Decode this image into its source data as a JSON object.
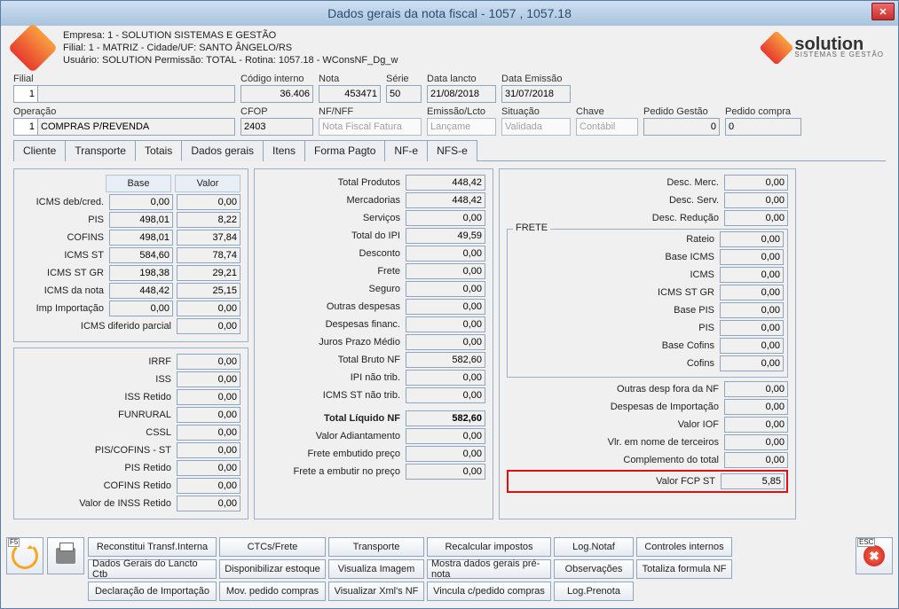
{
  "window": {
    "title": "Dados gerais da nota fiscal - 1057 , 1057.18"
  },
  "header": {
    "empresa_line": "Empresa: 1 - SOLUTION SISTEMAS E GESTÃO",
    "filial_line": "Filial: 1 - MATRIZ - Cidade/UF: SANTO ÂNGELO/RS",
    "usuario_line": "Usuário: SOLUTION          Permissão: TOTAL - Rotina: 1057.18 - WConsNF_Dg_w",
    "brand": "solution",
    "brand_sub": "SISTEMAS E GESTÃO"
  },
  "top": {
    "filial": {
      "label": "Filial",
      "num": "1",
      "text": ""
    },
    "codigo_interno": {
      "label": "Código interno",
      "value": "36.406"
    },
    "nota": {
      "label": "Nota",
      "value": "453471"
    },
    "serie": {
      "label": "Série",
      "value": "50"
    },
    "data_lancto": {
      "label": "Data lancto",
      "value": "21/08/2018"
    },
    "data_emissao": {
      "label": "Data Emissão",
      "value": "31/07/2018"
    },
    "operacao": {
      "label": "Operação",
      "num": "1",
      "text": "COMPRAS P/REVENDA"
    },
    "cfop": {
      "label": "CFOP",
      "value": "2403"
    },
    "nfnff": {
      "label": "NF/NFF",
      "value": "Nota Fiscal Fatura"
    },
    "emissao_lcto": {
      "label": "Emissão/Lcto",
      "value": "Lançame"
    },
    "situacao": {
      "label": "Situação",
      "value": "Validada"
    },
    "chave": {
      "label": "Chave",
      "value": "Contábil"
    },
    "pedido_gestao": {
      "label": "Pedido Gestão",
      "value": "0"
    },
    "pedido_compra": {
      "label": "Pedido compra",
      "value": "0"
    }
  },
  "tabs": [
    "Cliente",
    "Transporte",
    "Totais",
    "Dados gerais",
    "Itens",
    "Forma Pagto",
    "NF-e",
    "NFS-e"
  ],
  "active_tab": "Totais",
  "col1a": {
    "hdr_base": "Base",
    "hdr_valor": "Valor",
    "rows": [
      {
        "lbl": "ICMS deb/cred.",
        "base": "0,00",
        "valor": "0,00"
      },
      {
        "lbl": "PIS",
        "base": "498,01",
        "valor": "8,22"
      },
      {
        "lbl": "COFINS",
        "base": "498,01",
        "valor": "37,84"
      },
      {
        "lbl": "ICMS ST",
        "base": "584,60",
        "valor": "78,74"
      },
      {
        "lbl": "ICMS ST GR",
        "base": "198,38",
        "valor": "29,21"
      },
      {
        "lbl": "ICMS da nota",
        "base": "448,42",
        "valor": "25,15"
      },
      {
        "lbl": "Imp Importação",
        "base": "0,00",
        "valor": "0,00"
      }
    ],
    "diferido": {
      "lbl": "ICMS diferido parcial",
      "valor": "0,00"
    }
  },
  "col1b": [
    {
      "lbl": "IRRF",
      "valor": "0,00"
    },
    {
      "lbl": "ISS",
      "valor": "0,00"
    },
    {
      "lbl": "ISS Retido",
      "valor": "0,00"
    },
    {
      "lbl": "FUNRURAL",
      "valor": "0,00"
    },
    {
      "lbl": "CSSL",
      "valor": "0,00"
    },
    {
      "lbl": "PIS/COFINS - ST",
      "valor": "0,00"
    },
    {
      "lbl": "PIS Retido",
      "valor": "0,00"
    },
    {
      "lbl": "COFINS Retido",
      "valor": "0,00"
    },
    {
      "lbl": "Valor de INSS Retido",
      "valor": "0,00"
    }
  ],
  "col2": {
    "rows": [
      {
        "lbl": "Total Produtos",
        "valor": "448,42"
      },
      {
        "lbl": "Mercadorias",
        "valor": "448,42"
      },
      {
        "lbl": "Serviços",
        "valor": "0,00"
      },
      {
        "lbl": "Total do IPI",
        "valor": "49,59"
      },
      {
        "lbl": "Desconto",
        "valor": "0,00"
      },
      {
        "lbl": "Frete",
        "valor": "0,00"
      },
      {
        "lbl": "Seguro",
        "valor": "0,00"
      },
      {
        "lbl": "Outras despesas",
        "valor": "0,00"
      },
      {
        "lbl": "Despesas financ.",
        "valor": "0,00"
      },
      {
        "lbl": "Juros Prazo Médio",
        "valor": "0,00"
      },
      {
        "lbl": "Total Bruto NF",
        "valor": "582,60"
      },
      {
        "lbl": "IPI não trib.",
        "valor": "0,00"
      },
      {
        "lbl": "ICMS ST não trib.",
        "valor": "0,00"
      }
    ],
    "total_liquido": {
      "lbl": "Total Líquido NF",
      "valor": "582,60"
    },
    "tail": [
      {
        "lbl": "Valor Adiantamento",
        "valor": "0,00"
      },
      {
        "lbl": "Frete embutido preço",
        "valor": "0,00"
      },
      {
        "lbl": "Frete a embutir no preço",
        "valor": "0,00"
      }
    ]
  },
  "col3": {
    "top": [
      {
        "lbl": "Desc. Merc.",
        "valor": "0,00"
      },
      {
        "lbl": "Desc. Serv.",
        "valor": "0,00"
      },
      {
        "lbl": "Desc. Redução",
        "valor": "0,00"
      }
    ],
    "frete_legend": "FRETE",
    "frete": [
      {
        "lbl": "Rateio",
        "valor": "0,00"
      },
      {
        "lbl": "Base ICMS",
        "valor": "0,00"
      },
      {
        "lbl": "ICMS",
        "valor": "0,00"
      },
      {
        "lbl": "ICMS ST GR",
        "valor": "0,00"
      },
      {
        "lbl": "Base PIS",
        "valor": "0,00"
      },
      {
        "lbl": "PIS",
        "valor": "0,00"
      },
      {
        "lbl": "Base Cofins",
        "valor": "0,00"
      },
      {
        "lbl": "Cofins",
        "valor": "0,00"
      }
    ],
    "bottom": [
      {
        "lbl": "Outras desp fora da NF",
        "valor": "0,00"
      },
      {
        "lbl": "Despesas de Importação",
        "valor": "0,00"
      },
      {
        "lbl": "Valor IOF",
        "valor": "0,00"
      },
      {
        "lbl": "Vlr. em nome de terceiros",
        "valor": "0,00"
      },
      {
        "lbl": "Complemento do total",
        "valor": "0,00"
      }
    ],
    "highlight": {
      "lbl": "Valor FCP ST",
      "valor": "5,85"
    }
  },
  "buttons": {
    "row1": [
      "Reconstitui Transf.Interna",
      "CTCs/Frete",
      "Transporte",
      "Recalcular impostos",
      "Log.Notaf",
      "Controles internos"
    ],
    "row2": [
      "Dados Gerais do Lancto Ctb",
      "Disponibilizar estoque",
      "Visualiza Imagem",
      "Mostra dados gerais pré-nota",
      "Observações",
      "Totaliza formula NF"
    ],
    "row3": [
      "Declaração de Importação",
      "Mov. pedido compras",
      "Visualizar Xml's NF",
      "Vincula c/pedido compras",
      "Log.Prenota"
    ]
  },
  "btnw": [
    145,
    120,
    108,
    140,
    90,
    108
  ],
  "f5": "F5",
  "esc": "ESC"
}
